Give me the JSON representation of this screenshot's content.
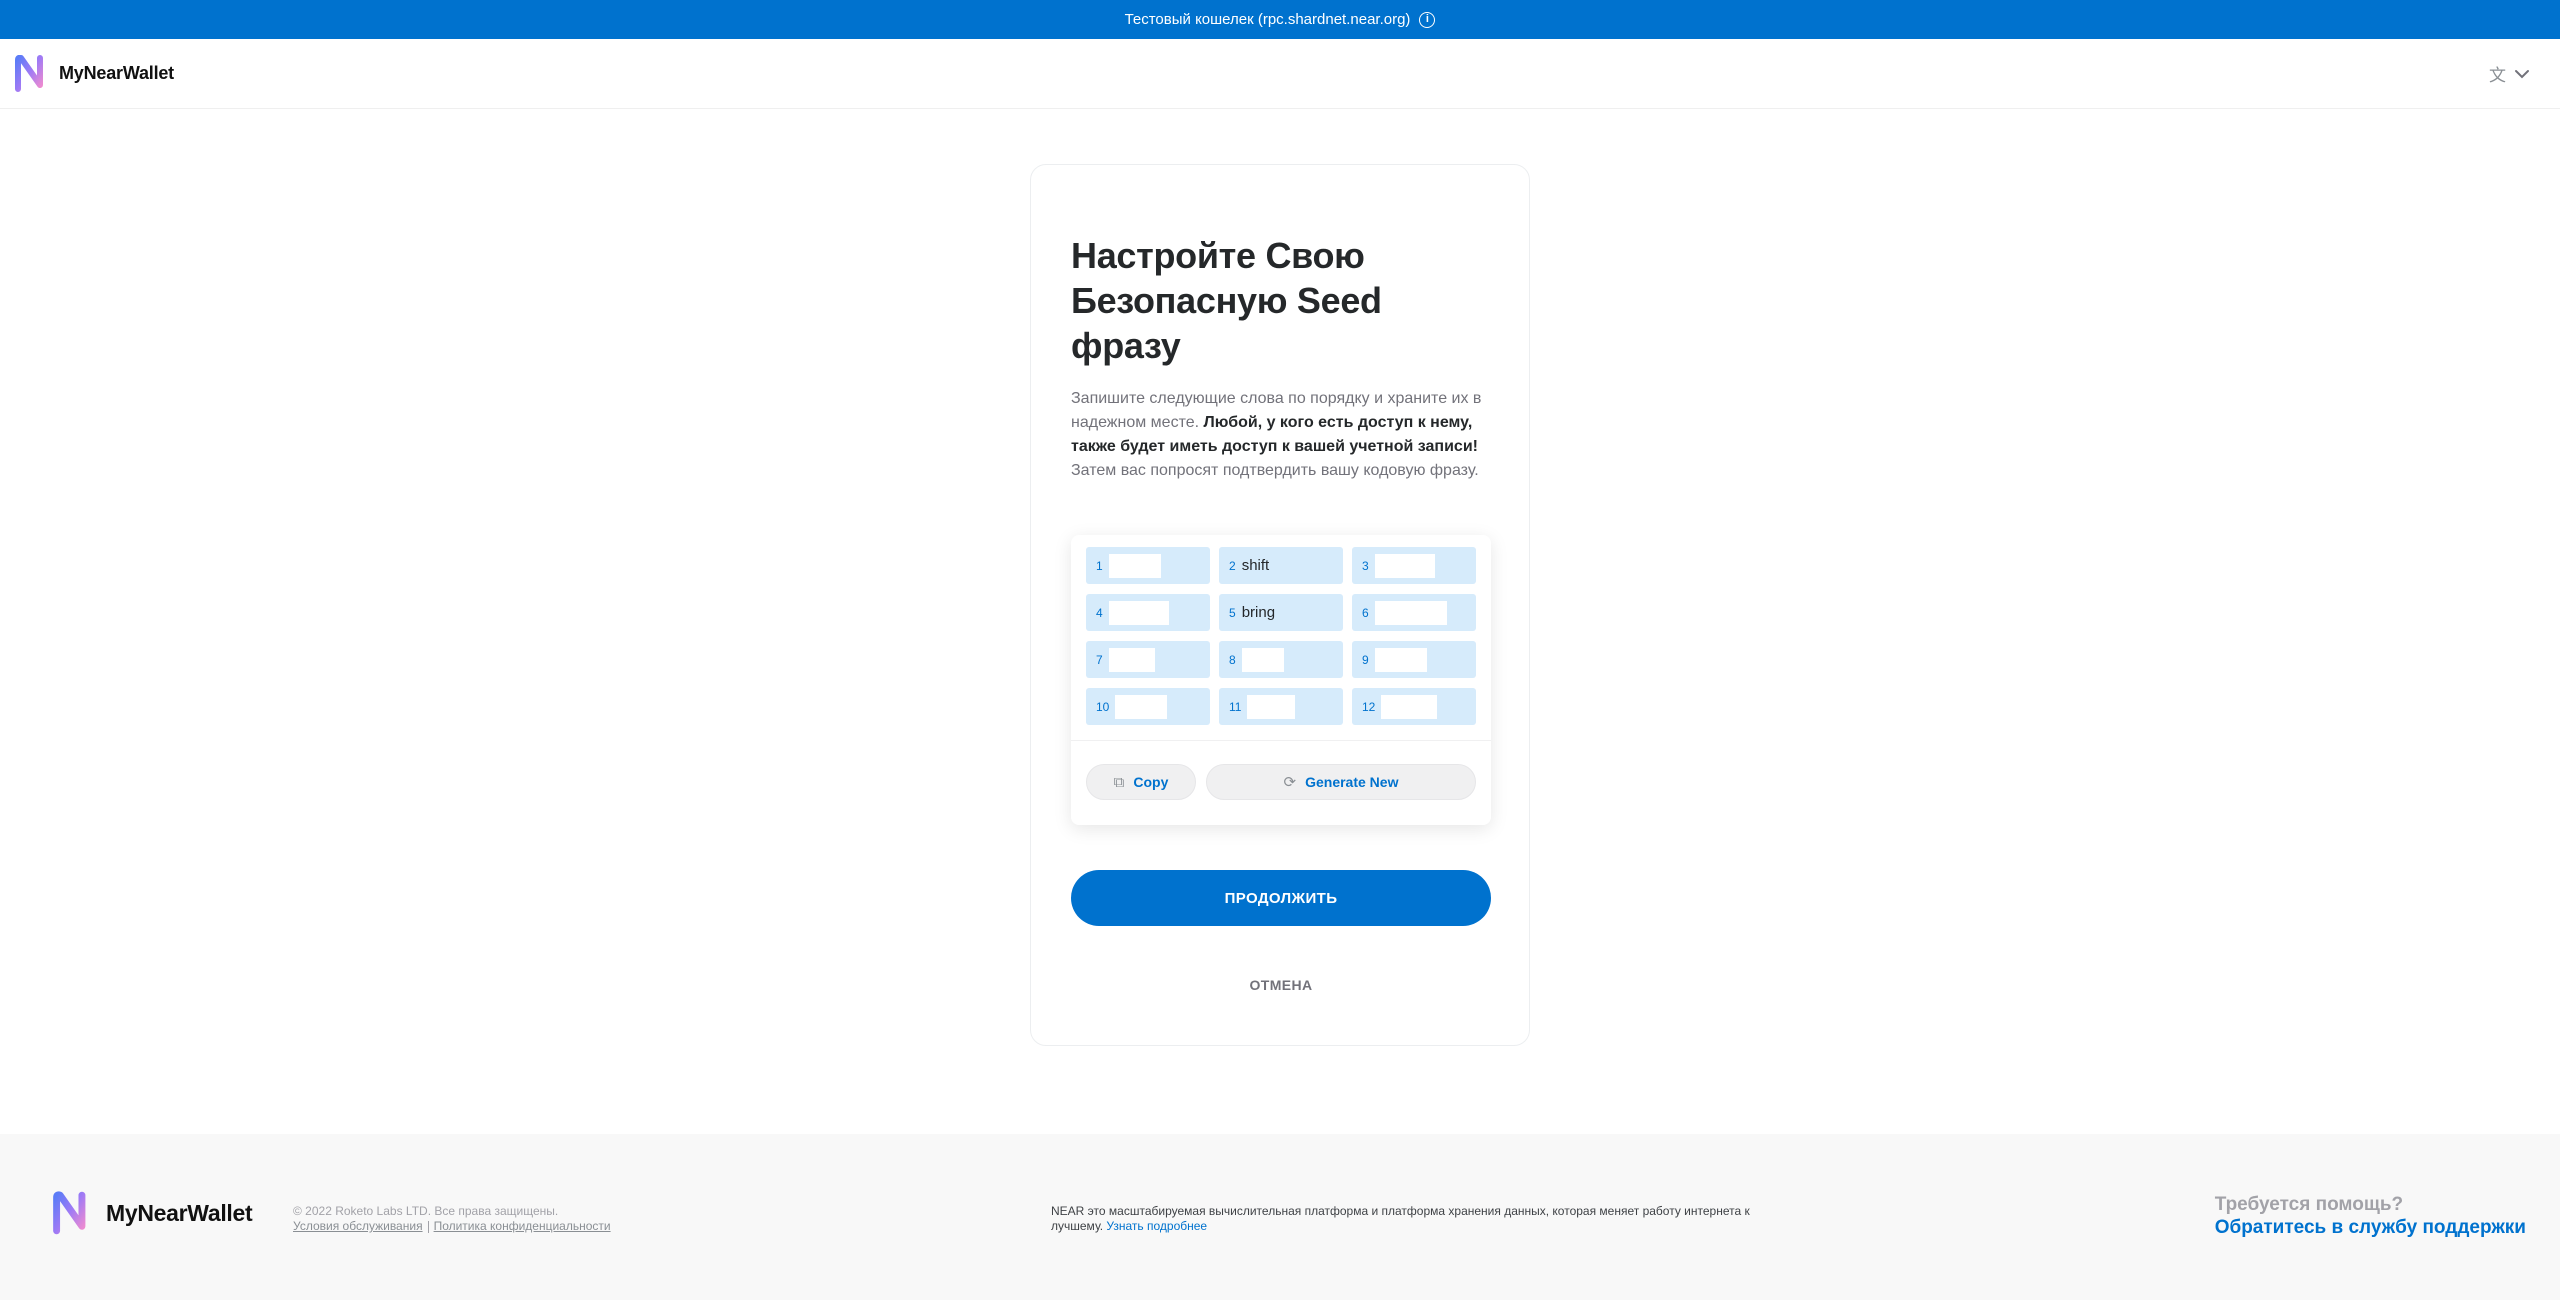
{
  "banner": {
    "text": "Тестовый кошелек (rpc.shardnet.near.org)",
    "icon": "info-icon"
  },
  "header": {
    "brand": "MyNearWallet",
    "logo_icon": "mynearwallet-logo-icon",
    "lang_icon": "translate-icon"
  },
  "card": {
    "title": "Настройте Свою Безопасную Seed фразу",
    "desc_part1": "Запишите следующие слова по порядку и храните их в надежном месте. ",
    "desc_bold": "Любой, у кого есть доступ к нему, также будет иметь доступ к вашей учетной записи!",
    "desc_part2": " Затем вас попросят подтвердить вашу кодовую фразу.",
    "words": [
      {
        "num": "1",
        "word": ""
      },
      {
        "num": "2",
        "word": "shift"
      },
      {
        "num": "3",
        "word": ""
      },
      {
        "num": "4",
        "word": ""
      },
      {
        "num": "5",
        "word": "bring"
      },
      {
        "num": "6",
        "word": ""
      },
      {
        "num": "7",
        "word": ""
      },
      {
        "num": "8",
        "word": ""
      },
      {
        "num": "9",
        "word": ""
      },
      {
        "num": "10",
        "word": ""
      },
      {
        "num": "11",
        "word": ""
      },
      {
        "num": "12",
        "word": ""
      }
    ],
    "copy_label": "Copy",
    "generate_label": "Generate New",
    "continue_label": "ПРОДОЛЖИТЬ",
    "cancel_label": "ОТМЕНА"
  },
  "footer": {
    "brand": "MyNearWallet",
    "copyright": "© 2022 Roketo Labs LTD. Все права защищены.",
    "terms": "Условия обслуживания",
    "privacy": "Политика конфиденциальности",
    "about": "NEAR это масштабируемая вычислительная платформа и платформа хранения данных, которая меняет работу интернета к лучшему.",
    "learn_more": "Узнать подробнее",
    "help_question": "Требуется помощь?",
    "help_link": "Обратитесь в службу поддержки"
  },
  "colors": {
    "accent": "#0072ce",
    "word_bg": "#d6ebfb",
    "footer_bg": "#f8f8f8"
  }
}
